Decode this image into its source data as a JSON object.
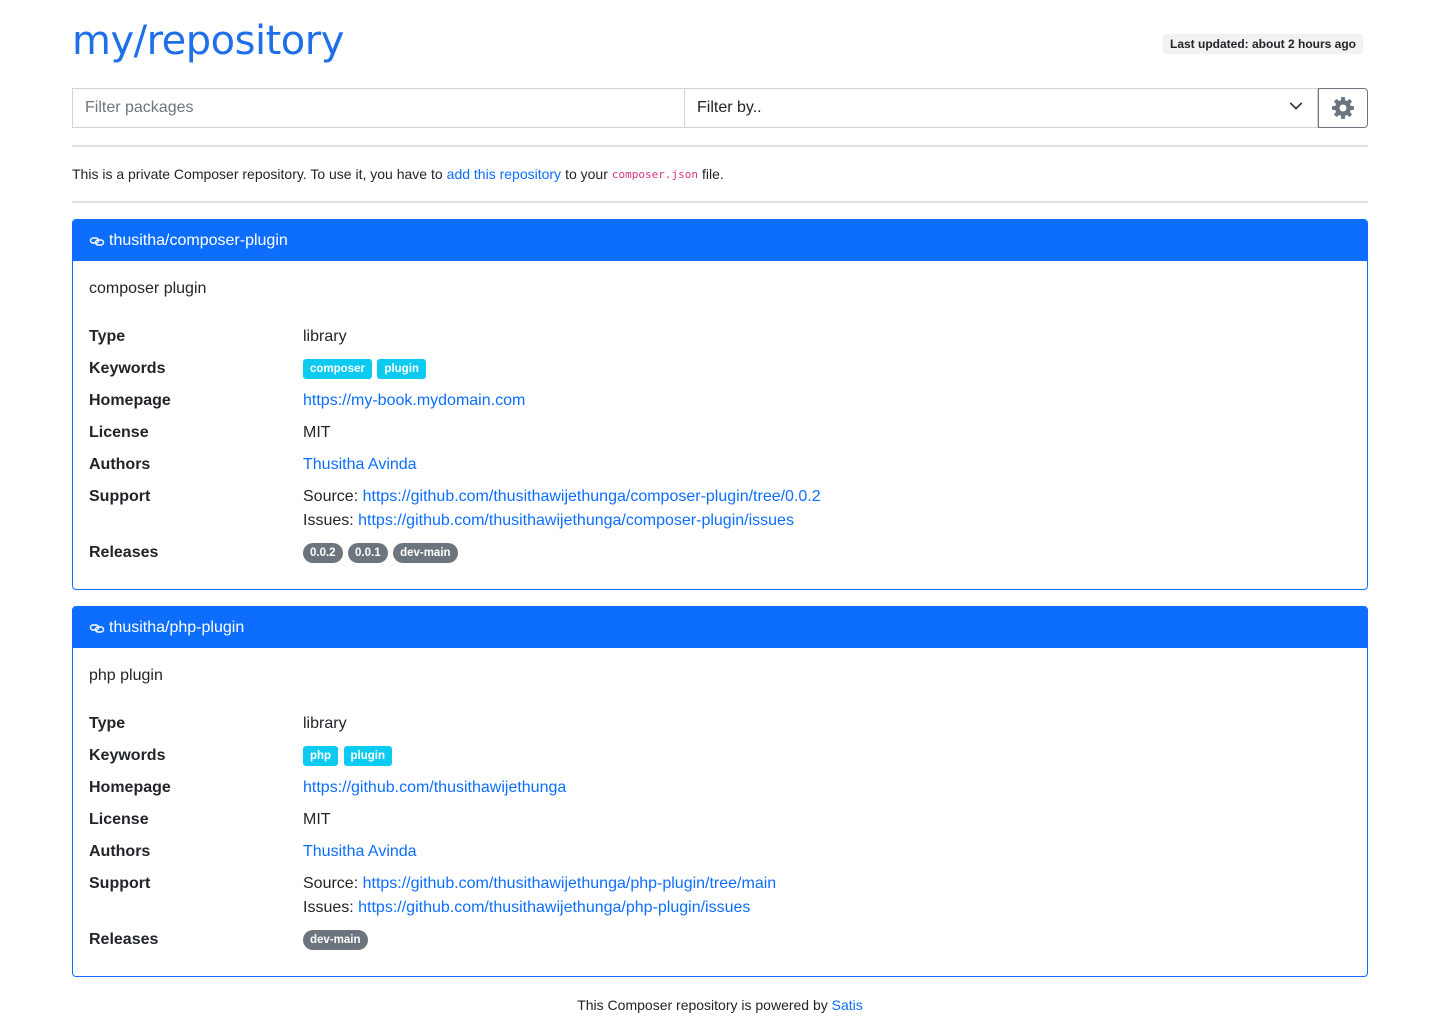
{
  "header": {
    "title": "my/repository",
    "last_updated": "Last updated: about 2 hours ago"
  },
  "filters": {
    "search_placeholder": "Filter packages",
    "search_value": "",
    "filter_by_label": "Filter by.."
  },
  "intro": {
    "text_before": "This is a private Composer repository. To use it, you have to",
    "link_text": "add this repository",
    "text_middle": "to your",
    "code": "composer.json",
    "text_after": "file."
  },
  "labels": {
    "type": "Type",
    "keywords": "Keywords",
    "homepage": "Homepage",
    "license": "License",
    "authors": "Authors",
    "support": "Support",
    "releases": "Releases",
    "source_prefix": "Source:",
    "issues_prefix": "Issues:"
  },
  "packages": [
    {
      "name": "thusitha/composer-plugin",
      "description": "composer plugin",
      "type": "library",
      "keywords": [
        "composer",
        "plugin"
      ],
      "homepage": "https://my-book.mydomain.com",
      "license": "MIT",
      "authors": "Thusitha Avinda",
      "support_source": "https://github.com/thusithawijethunga/composer-plugin/tree/0.0.2",
      "support_issues": "https://github.com/thusithawijethunga/composer-plugin/issues",
      "releases": [
        "0.0.2",
        "0.0.1",
        "dev-main"
      ]
    },
    {
      "name": "thusitha/php-plugin",
      "description": "php plugin",
      "type": "library",
      "keywords": [
        "php",
        "plugin"
      ],
      "homepage": "https://github.com/thusithawijethunga",
      "license": "MIT",
      "authors": "Thusitha Avinda",
      "support_source": "https://github.com/thusithawijethunga/php-plugin/tree/main",
      "support_issues": "https://github.com/thusithawijethunga/php-plugin/issues",
      "releases": [
        "dev-main"
      ]
    }
  ],
  "footer": {
    "text": "This Composer repository is powered by",
    "link_text": "Satis"
  },
  "colors": {
    "primary": "#0d6efd",
    "keyword_badge": "#0dcaf0",
    "release_badge": "#6c757d"
  },
  "icons": {
    "package_header": "link-icon",
    "settings": "gear-icon",
    "select": "chevron-down-icon"
  }
}
